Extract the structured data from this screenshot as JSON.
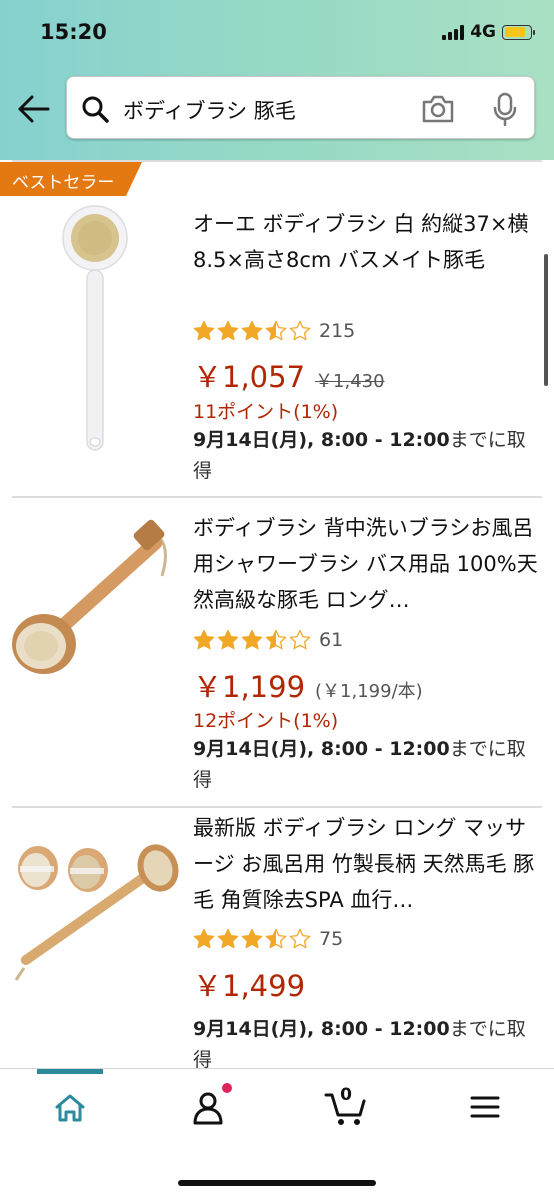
{
  "status_bar": {
    "time": "15:20",
    "network": "4G"
  },
  "search": {
    "query": "ボディブラシ 豚毛"
  },
  "colors": {
    "accent_teal": "#2c8a9c",
    "price_red": "#b12704",
    "badge_orange": "#e47911",
    "star_gold": "#f0a826",
    "header_gradient_start": "#86d1cf",
    "header_gradient_end": "#a9e0c3"
  },
  "products": [
    {
      "badge": "ベストセラー",
      "title": "オーエ ボディブラシ 白 約縦37×横8.5×高さ8cm バスメイト豚毛",
      "rating": 3.5,
      "review_count": "215",
      "price": "￥1,057",
      "old_price": "￥1,430",
      "points": "11ポイント(1%)",
      "delivery_date": "9月14日(月), 8:00 - 12:00",
      "delivery_suffix": "までに取得"
    },
    {
      "title": "ボディブラシ 背中洗いブラシお風呂用シャワーブラシ バス用品 100%天然高級な豚毛 ロング…",
      "rating": 3.5,
      "review_count": "61",
      "price": "￥1,199",
      "unit_price": "(￥1,199/本)",
      "points": "12ポイント(1%)",
      "delivery_date": "9月14日(月), 8:00 - 12:00",
      "delivery_suffix": "までに取得"
    },
    {
      "title": "最新版 ボディブラシ ロング マッサージ お風呂用 竹製長柄 天然馬毛 豚毛 角質除去SPA 血行…",
      "rating": 3.5,
      "review_count": "75",
      "price": "￥1,499",
      "delivery_date": "9月14日(月), 8:00 - 12:00",
      "delivery_suffix": "までに取得"
    }
  ],
  "bottom_nav": {
    "items": [
      {
        "name": "home",
        "icon": "home-icon"
      },
      {
        "name": "account",
        "icon": "person-icon"
      },
      {
        "name": "cart",
        "icon": "cart-icon",
        "count": "0"
      },
      {
        "name": "menu",
        "icon": "hamburger-menu-icon"
      }
    ]
  }
}
